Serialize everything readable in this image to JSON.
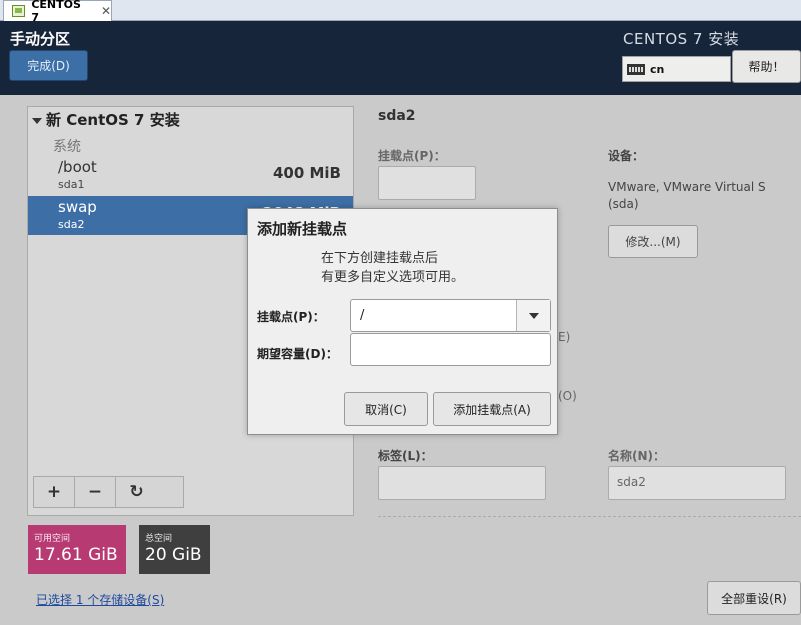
{
  "tab": {
    "label": "CENTOS 7",
    "close": "✕"
  },
  "header": {
    "title": "手动分区",
    "done_button": "完成(D)",
    "product": "CENTOS 7 安装",
    "keyboard_layout": "cn",
    "help_button": "帮助！"
  },
  "left_panel": {
    "group_title": "新 CentOS 7 安装",
    "section": "系统",
    "partitions": [
      {
        "mount": "/boot",
        "device": "sda1",
        "size": "400 MiB",
        "selected": false
      },
      {
        "mount": "swap",
        "device": "sda2",
        "size": "2048 MiB",
        "selected": true
      }
    ],
    "toolbar": {
      "add": "+",
      "remove": "−",
      "refresh": "↻"
    }
  },
  "space": {
    "available_label": "可用空间",
    "available_value": "17.61 GiB",
    "total_label": "总空间",
    "total_value": "20 GiB"
  },
  "storage_link": "已选择 1 个存储设备(S)",
  "reset_button": "全部重设(R)",
  "detail": {
    "title": "sda2",
    "mount_label": "挂载点(P)：",
    "device_label": "设备：",
    "device_text": "VMware, VMware Virtual S (sda)",
    "modify_button": "修改...(M)",
    "peek_e": "E)",
    "peek_o": "(O)",
    "tag_label": "标签(L)：",
    "name_label": "名称(N)：",
    "name_value": "sda2"
  },
  "dialog": {
    "title": "添加新挂载点",
    "message_line1": "在下方创建挂载点后",
    "message_line2": "有更多自定义选项可用。",
    "mount_label": "挂载点(P)：",
    "mount_value": "/",
    "capacity_label": "期望容量(D)：",
    "capacity_value": "",
    "cancel_button": "取消(C)",
    "add_button": "添加挂载点(A)"
  },
  "colors": {
    "header_bg": "#17253a",
    "accent": "#3d6fa6",
    "available": "#b83a73",
    "total": "#3f3f3f"
  }
}
